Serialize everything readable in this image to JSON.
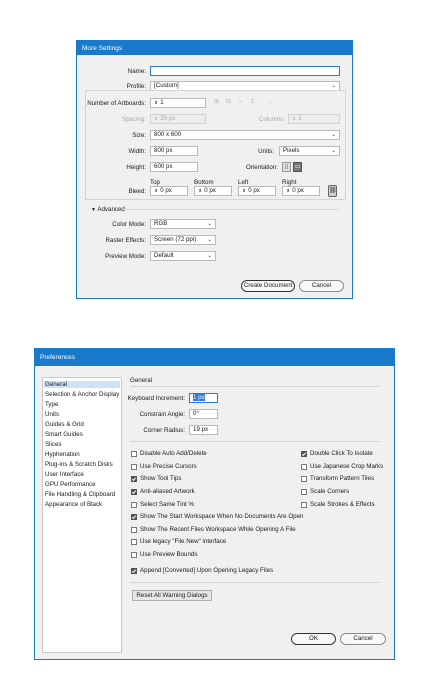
{
  "more_settings": {
    "title": "More Settings",
    "name_label": "Name:",
    "name_value": "",
    "profile_label": "Profile:",
    "profile_value": "[Custom]",
    "artboards_label": "Number of Artboards:",
    "artboards_value": "1",
    "spacing_label": "Spacing:",
    "spacing_value": "20 px",
    "columns_label": "Columns:",
    "columns_value": "1",
    "size_label": "Size:",
    "size_value": "800 x 600",
    "width_label": "Width:",
    "width_value": "800 px",
    "units_label": "Units:",
    "units_value": "Pixels",
    "height_label": "Height:",
    "height_value": "600 px",
    "orientation_label": "Orientation:",
    "bleed_label": "Bleed:",
    "bleed_top_label": "Top",
    "bleed_bottom_label": "Bottom",
    "bleed_left_label": "Left",
    "bleed_right_label": "Right",
    "bleed_top": "0 px",
    "bleed_bottom": "0 px",
    "bleed_left": "0 px",
    "bleed_right": "0 px",
    "advanced_label": "Advanced",
    "color_mode_label": "Color Mode:",
    "color_mode_value": "RGB",
    "raster_label": "Raster Effects:",
    "raster_value": "Screen (72 ppi)",
    "preview_label": "Preview Mode:",
    "preview_value": "Default",
    "create_button": "Create Document",
    "cancel_button": "Cancel"
  },
  "preferences": {
    "title": "Preferences",
    "sidebar": [
      "General",
      "Selection & Anchor Display",
      "Type",
      "Units",
      "Guides & Grid",
      "Smart Guides",
      "Slices",
      "Hyphenation",
      "Plug-ins & Scratch Disks",
      "User Interface",
      "GPU Performance",
      "File Handling & Clipboard",
      "Appearance of Black"
    ],
    "selected_index": 0,
    "section_title": "General",
    "keyboard_increment_label": "Keyboard Increment:",
    "keyboard_increment_value": "1 px",
    "constrain_angle_label": "Constrain Angle:",
    "constrain_angle_value": "0°",
    "corner_radius_label": "Corner Radius:",
    "corner_radius_value": "19 px",
    "left_options": [
      {
        "label": "Disable Auto Add/Delete",
        "checked": false
      },
      {
        "label": "Use Precise Cursors",
        "checked": false
      },
      {
        "label": "Show Tool Tips",
        "checked": true
      },
      {
        "label": "Anti-aliased Artwork",
        "checked": true
      },
      {
        "label": "Select Same Tint %",
        "checked": false
      },
      {
        "label": "Show The Start Workspace When No Documents Are Open",
        "checked": true
      },
      {
        "label": "Show The Recent Files Workspace While Opening A File",
        "checked": false
      },
      {
        "label": "Use legacy \"File New\" interface",
        "checked": false
      },
      {
        "label": "Use Preview Bounds",
        "checked": false
      },
      {
        "label": "Append [Converted] Upon Opening Legacy Files",
        "checked": true
      }
    ],
    "right_options": [
      {
        "label": "Double Click To Isolate",
        "checked": true
      },
      {
        "label": "Use Japanese Crop Marks",
        "checked": false
      },
      {
        "label": "Transform Pattern Tiles",
        "checked": false
      },
      {
        "label": "Scale Corners",
        "checked": false
      },
      {
        "label": "Scale Strokes & Effects",
        "checked": false
      }
    ],
    "reset_button": "Reset All Warning Dialogs",
    "ok_button": "OK",
    "cancel_button": "Cancel"
  }
}
